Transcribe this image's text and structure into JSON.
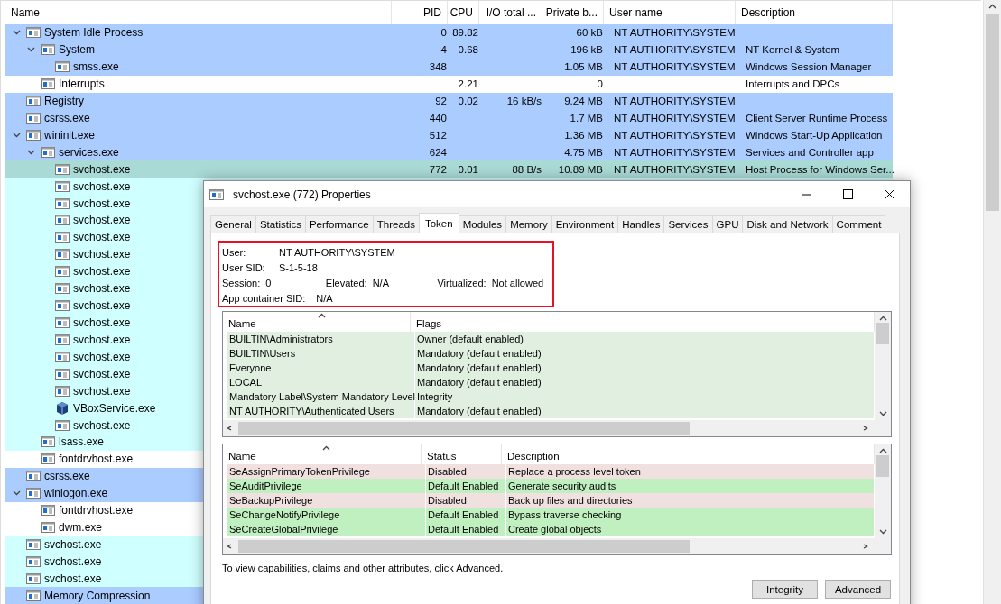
{
  "process_tree": {
    "columns": [
      "Name",
      "PID",
      "CPU",
      "I/O total ...",
      "Private b...",
      "User name",
      "Description"
    ],
    "rows": [
      {
        "name": "System Idle Process",
        "pid": "0",
        "cpu": "89.82",
        "private_bytes": "60 kB",
        "user_name": "NT AUTHORITY\\SYSTEM",
        "color": "#aaccff",
        "expanded": true,
        "children": [
          {
            "name": "System",
            "pid": "4",
            "cpu": "0.68",
            "private_bytes": "196 kB",
            "user_name": "NT AUTHORITY\\SYSTEM",
            "description": "NT Kernel & System",
            "color": "#aaccff",
            "expanded": true,
            "children": [
              {
                "name": "smss.exe",
                "pid": "348",
                "private_bytes": "1.05 MB",
                "user_name": "NT AUTHORITY\\SYSTEM",
                "description": "Windows Session Manager",
                "color": "#aaccff"
              }
            ]
          },
          {
            "name": "Interrupts",
            "cpu": "2.21",
            "private_bytes": "0",
            "description": "Interrupts and DPCs",
            "color": "#ffffff"
          }
        ]
      },
      {
        "name": "Registry",
        "pid": "92",
        "cpu": "0.02",
        "io_total": "16 kB/s",
        "private_bytes": "9.24 MB",
        "user_name": "NT AUTHORITY\\SYSTEM",
        "color": "#aaccff"
      },
      {
        "name": "csrss.exe",
        "pid": "440",
        "private_bytes": "1.7 MB",
        "user_name": "NT AUTHORITY\\SYSTEM",
        "description": "Client Server Runtime Process",
        "color": "#aaccff"
      },
      {
        "name": "wininit.exe",
        "pid": "512",
        "private_bytes": "1.36 MB",
        "user_name": "NT AUTHORITY\\SYSTEM",
        "description": "Windows Start-Up Application",
        "color": "#aaccff",
        "expanded": true,
        "children": [
          {
            "name": "services.exe",
            "pid": "624",
            "private_bytes": "4.75 MB",
            "user_name": "NT AUTHORITY\\SYSTEM",
            "description": "Services and Controller app",
            "color": "#aaccff",
            "expanded": true,
            "children": [
              {
                "name": "svchost.exe",
                "pid": "772",
                "cpu": "0.01",
                "io_total": "88 B/s",
                "private_bytes": "10.89 MB",
                "user_name": "NT AUTHORITY\\SYSTEM",
                "description": "Host Process for Windows Ser...",
                "color": "#aadad6"
              },
              {
                "name": "svchost.exe",
                "color": "#d0ffff"
              },
              {
                "name": "svchost.exe",
                "color": "#d0ffff"
              },
              {
                "name": "svchost.exe",
                "color": "#d0ffff"
              },
              {
                "name": "svchost.exe",
                "color": "#d0ffff"
              },
              {
                "name": "svchost.exe",
                "color": "#d0ffff"
              },
              {
                "name": "svchost.exe",
                "color": "#d0ffff"
              },
              {
                "name": "svchost.exe",
                "color": "#d0ffff"
              },
              {
                "name": "svchost.exe",
                "color": "#d0ffff"
              },
              {
                "name": "svchost.exe",
                "color": "#d0ffff"
              },
              {
                "name": "svchost.exe",
                "color": "#d0ffff"
              },
              {
                "name": "svchost.exe",
                "color": "#d0ffff"
              },
              {
                "name": "svchost.exe",
                "color": "#d0ffff"
              },
              {
                "name": "svchost.exe",
                "color": "#d0ffff"
              },
              {
                "name": "VBoxService.exe",
                "kind": "third-party",
                "color": "#d0ffff"
              },
              {
                "name": "svchost.exe",
                "color": "#d0ffff"
              }
            ]
          },
          {
            "name": "lsass.exe",
            "color": "#d0ffff"
          },
          {
            "name": "fontdrvhost.exe",
            "color": "#ffffff"
          }
        ]
      },
      {
        "name": "csrss.exe",
        "color": "#aaccff"
      },
      {
        "name": "winlogon.exe",
        "color": "#aaccff",
        "expanded": true,
        "children": [
          {
            "name": "fontdrvhost.exe",
            "color": "#ffffff"
          },
          {
            "name": "dwm.exe",
            "color": "#ffffff"
          }
        ]
      },
      {
        "name": "svchost.exe",
        "color": "#d0ffff"
      },
      {
        "name": "svchost.exe",
        "color": "#d0ffff"
      },
      {
        "name": "svchost.exe",
        "color": "#d0ffff"
      },
      {
        "name": "Memory Compression",
        "color": "#aaccff"
      }
    ]
  },
  "properties_window": {
    "title": "svchost.exe (772) Properties",
    "tabs": [
      {
        "label": "General",
        "selected": false
      },
      {
        "label": "Statistics",
        "selected": false
      },
      {
        "label": "Performance",
        "selected": false
      },
      {
        "label": "Threads",
        "selected": false
      },
      {
        "label": "Token",
        "selected": true
      },
      {
        "label": "Modules",
        "selected": false
      },
      {
        "label": "Memory",
        "selected": false
      },
      {
        "label": "Environment",
        "selected": false
      },
      {
        "label": "Handles",
        "selected": false
      },
      {
        "label": "Services",
        "selected": false
      },
      {
        "label": "GPU",
        "selected": false
      },
      {
        "label": "Disk and Network",
        "selected": false
      },
      {
        "label": "Comment",
        "selected": false
      }
    ],
    "token_info": [
      [
        {
          "label": "User:",
          "value": "NT AUTHORITY\\SYSTEM"
        }
      ],
      [
        {
          "label": "User SID:",
          "value": "S-1-5-18"
        }
      ],
      [
        {
          "label": "Session:",
          "value": "0"
        },
        {
          "label": "Elevated:",
          "value": "N/A"
        },
        {
          "label": "Virtualized:",
          "value": "Not allowed"
        }
      ],
      [
        {
          "label": "App container SID:",
          "value": "N/A"
        }
      ]
    ],
    "groups": {
      "columns": [
        "Name",
        "Flags"
      ],
      "rows": [
        {
          "name": "BUILTIN\\Administrators",
          "flags": "Owner (default enabled)"
        },
        {
          "name": "BUILTIN\\Users",
          "flags": "Mandatory (default enabled)"
        },
        {
          "name": "Everyone",
          "flags": "Mandatory (default enabled)"
        },
        {
          "name": "LOCAL",
          "flags": "Mandatory (default enabled)"
        },
        {
          "name": "Mandatory Label\\System Mandatory Level",
          "flags": "Integrity"
        },
        {
          "name": "NT AUTHORITY\\Authenticated Users",
          "flags": "Mandatory (default enabled)"
        }
      ]
    },
    "privileges": {
      "columns": [
        "Name",
        "Status",
        "Description"
      ],
      "rows": [
        {
          "name": "SeAssignPrimaryTokenPrivilege",
          "status": "Disabled",
          "description": "Replace a process level token",
          "color": "#f0e0e0"
        },
        {
          "name": "SeAuditPrivilege",
          "status": "Default Enabled",
          "description": "Generate security audits",
          "color": "#c0f0c0"
        },
        {
          "name": "SeBackupPrivilege",
          "status": "Disabled",
          "description": "Back up files and directories",
          "color": "#f0e0e0"
        },
        {
          "name": "SeChangeNotifyPrivilege",
          "status": "Default Enabled",
          "description": "Bypass traverse checking",
          "color": "#c0f0c0"
        },
        {
          "name": "SeCreateGlobalPrivilege",
          "status": "Default Enabled",
          "description": "Create global objects",
          "color": "#c0f0c0"
        }
      ]
    },
    "hint": "To view capabilities, claims and other attributes, click Advanced.",
    "buttons": [
      "Integrity",
      "Advanced"
    ]
  }
}
